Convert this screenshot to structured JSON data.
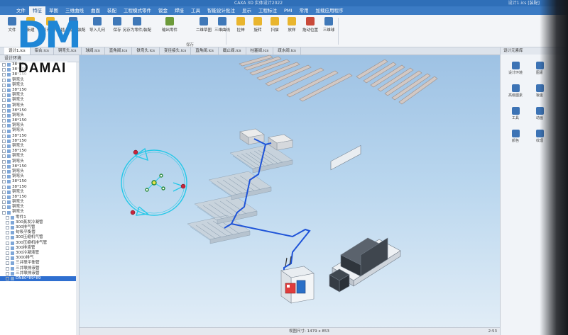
{
  "window": {
    "title": "CAXA 3D 实体设计2022",
    "file_info": "设计1.ics [装配]"
  },
  "menu": {
    "tabs": [
      "文件",
      "特征",
      "草图",
      "三维曲线",
      "曲面",
      "装配",
      "工程模式零件",
      "钣金",
      "焊接",
      "工具",
      "智能设计批注",
      "显示",
      "工程标注",
      "PMI",
      "常用",
      "加载应用程序"
    ],
    "active_index": 1
  },
  "ribbon": {
    "buttons": [
      {
        "label": "文件",
        "color": "#3f78b8"
      },
      {
        "label": "新建",
        "color": "#e9b52e"
      },
      {
        "label": "打开文件",
        "color": "#e9b52e"
      },
      {
        "label": "插入零件/装配",
        "color": "#3f78b8"
      },
      {
        "label": "导入几何",
        "color": "#3f78b8"
      },
      {
        "label": "保存",
        "color": "#3f78b8"
      },
      {
        "label": "另存为零件/装配",
        "color": "#3f78b8"
      },
      {
        "label": "输出零件",
        "color": "#6c9a3a"
      },
      {
        "label": "二维草图",
        "color": "#3f78b8"
      },
      {
        "label": "三维曲线",
        "color": "#3f78b8"
      },
      {
        "label": "拉伸",
        "color": "#e9b52e"
      },
      {
        "label": "旋转",
        "color": "#e9b52e"
      },
      {
        "label": "扫描",
        "color": "#e9b52e"
      },
      {
        "label": "放样",
        "color": "#e9b52e"
      },
      {
        "label": "拖动位置",
        "color": "#c94a3a"
      },
      {
        "label": "三维球",
        "color": "#3f78b8"
      }
    ],
    "group_labels": [
      "保存"
    ]
  },
  "doc_tabs": [
    "设计1.ics",
    "铝合.ics",
    "铜弯头.ics",
    "球阀.ics",
    "直角阀.ics",
    "铁弯头.ics",
    "变径接头.ics",
    "直角阀.ics",
    "截止阀.ics",
    "柱塞阀.ics",
    "疏水阀.ics"
  ],
  "tree": {
    "header": "设计环境",
    "items": [
      "38*150",
      "38*150",
      "38*150",
      "铜弯头",
      "铜弯头",
      "38*150",
      "铜弯头",
      "铜弯头",
      "铜弯头",
      "38*150",
      "铜弯头",
      "38*150",
      "铜弯头",
      "铜弯头",
      "38*150",
      "38*150",
      "铜弯头",
      "38*150",
      "铜弯头",
      "铜弯头",
      "38*150",
      "铜弯头",
      "铜弯头",
      "38*150",
      "38*150",
      "铜弯头",
      "38*150",
      "铜弯头",
      "铜弯头",
      "铜弯头",
      "零件1",
      "300蒸发冷凝管",
      "300排气管",
      "旬吸平衡管",
      "300压缩机气管",
      "300压缩机排气管",
      "300排液管",
      "300冷凝液管",
      "3000排气",
      "三井联平衡管",
      "三井联排液管",
      "三井联排液管",
      "DN80*89*89"
    ],
    "selected_index": 42
  },
  "right_panel": {
    "header": "设计元素库",
    "items": [
      "设计环境",
      "图素",
      "高级图素",
      "钣金",
      "工具",
      "动画",
      "颜色",
      "纹理"
    ]
  },
  "status": {
    "coord": "视图尺寸: 1479 x 853",
    "time": "2:53"
  },
  "logo": {
    "mark": "DM",
    "word": "DAMAI"
  }
}
